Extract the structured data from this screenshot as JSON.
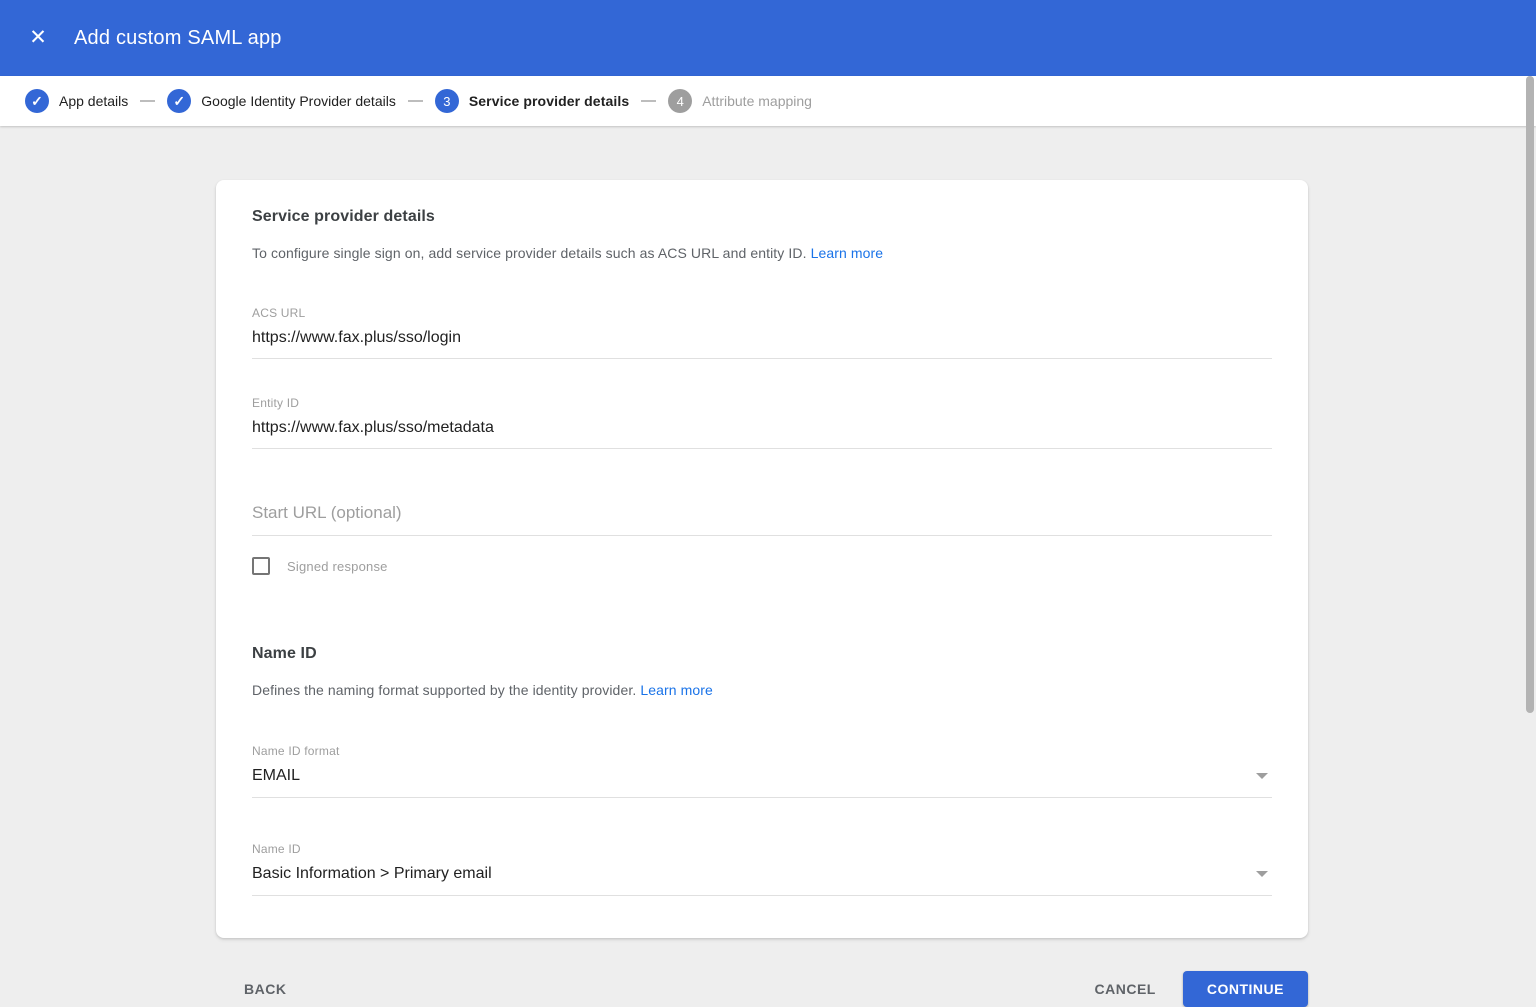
{
  "header": {
    "title": "Add custom SAML app"
  },
  "icons": {
    "close": "✕",
    "check": "✓"
  },
  "stepper": {
    "steps": [
      {
        "label": "App details",
        "state": "complete"
      },
      {
        "label": "Google Identity Provider details",
        "state": "complete"
      },
      {
        "label": "Service provider details",
        "state": "active",
        "number": "3"
      },
      {
        "label": "Attribute mapping",
        "state": "upcoming",
        "number": "4"
      }
    ]
  },
  "card": {
    "section1": {
      "title": "Service provider details",
      "description": "To configure single sign on, add service provider details such as ACS URL and entity ID.",
      "learn_more": "Learn more"
    },
    "fields": {
      "acs_url": {
        "label": "ACS URL",
        "value": "https://www.fax.plus/sso/login"
      },
      "entity_id": {
        "label": "Entity ID",
        "value": "https://www.fax.plus/sso/metadata"
      },
      "start_url": {
        "placeholder": "Start URL (optional)",
        "value": ""
      },
      "signed_response": {
        "label": "Signed response",
        "checked": false
      }
    },
    "name_id_section": {
      "title": "Name ID",
      "description": "Defines the naming format supported by the identity provider.",
      "learn_more": "Learn more",
      "name_id_format": {
        "label": "Name ID format",
        "value": "EMAIL"
      },
      "name_id": {
        "label": "Name ID",
        "value": "Basic Information > Primary email"
      }
    }
  },
  "footer": {
    "back_label": "BACK",
    "cancel_label": "CANCEL",
    "continue_label": "CONTINUE"
  },
  "colors": {
    "header_blue": "#3367d6",
    "link_blue": "#1a73e8",
    "inactive_gray": "#9e9e9e",
    "background_gray": "#eeeeee"
  }
}
